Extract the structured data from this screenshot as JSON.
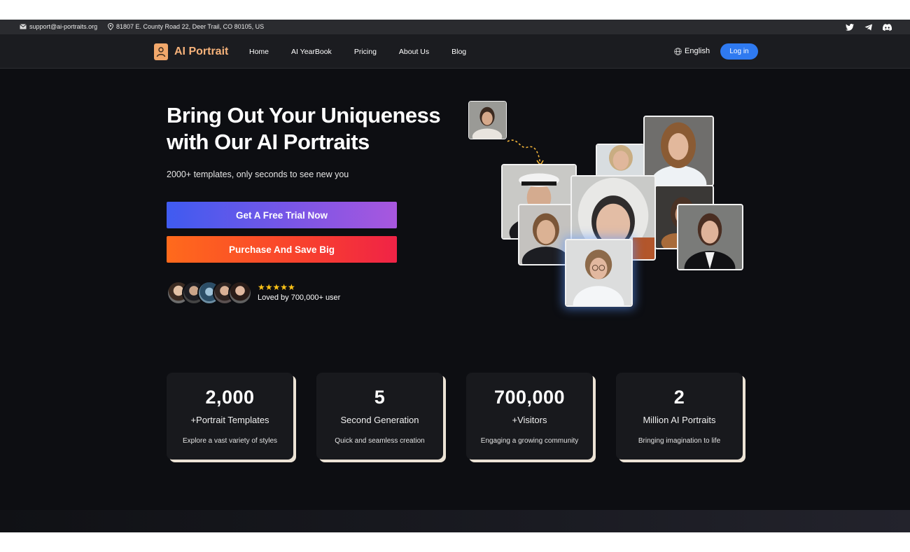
{
  "topbar": {
    "email": "support@ai-portraits.org",
    "address": "81807 E. County Road 22, Deer Trail, CO 80105, US",
    "socials": [
      "twitter-icon",
      "telegram-icon",
      "discord-icon"
    ]
  },
  "nav": {
    "brand": "AI Portrait",
    "links": [
      "Home",
      "AI YearBook",
      "Pricing",
      "About Us",
      "Blog"
    ],
    "language": "English",
    "login": "Log in"
  },
  "hero": {
    "title_line1": "Bring Out Your Uniqueness",
    "title_line2": "with Our AI Portraits",
    "subtitle": "2000+ templates, only seconds to see new you",
    "cta_trial": "Get A Free Trial Now",
    "cta_buy": "Purchase And Save Big",
    "stars": "★★★★★",
    "rating_count": 5,
    "loved": "Loved by 700,000+ user"
  },
  "stats": [
    {
      "num": "2,000",
      "label": "+Portrait Templates",
      "desc": "Explore a vast variety of styles"
    },
    {
      "num": "5",
      "label": "Second Generation",
      "desc": "Quick and seamless creation"
    },
    {
      "num": "700,000",
      "label": "+Visitors",
      "desc": "Engaging a growing community"
    },
    {
      "num": "2",
      "label": "Million AI Portraits",
      "desc": "Bringing imagination to life"
    }
  ],
  "colors": {
    "background": "#0d0e12",
    "brand": "#f6b27a",
    "login": "#2f7af0",
    "star": "#ffc417"
  }
}
